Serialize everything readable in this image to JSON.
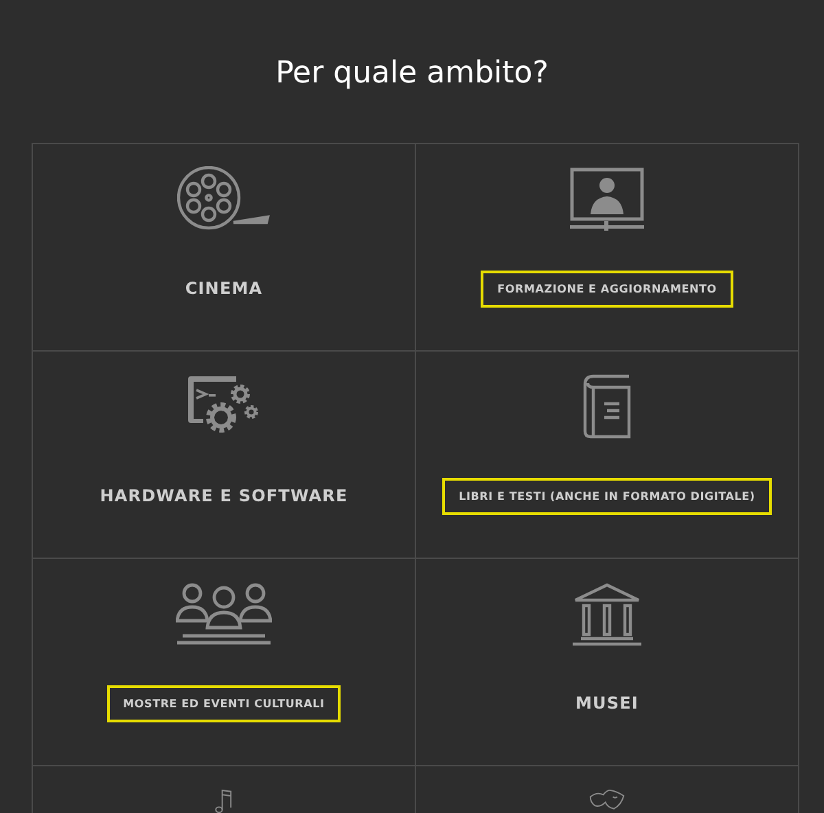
{
  "title": "Per quale ambito?",
  "areas": [
    {
      "label": "CINEMA",
      "highlighted": false
    },
    {
      "label": "FORMAZIONE E AGGIORNAMENTO",
      "highlighted": true
    },
    {
      "label": "HARDWARE E SOFTWARE",
      "highlighted": false
    },
    {
      "label": "LIBRI E TESTI (ANCHE IN FORMATO DIGITALE)",
      "highlighted": true
    },
    {
      "label": "MOSTRE ED EVENTI CULTURALI",
      "highlighted": true
    },
    {
      "label": "MUSEI",
      "highlighted": false
    },
    {
      "cut_off": true
    },
    {
      "cut_off": true
    }
  ]
}
